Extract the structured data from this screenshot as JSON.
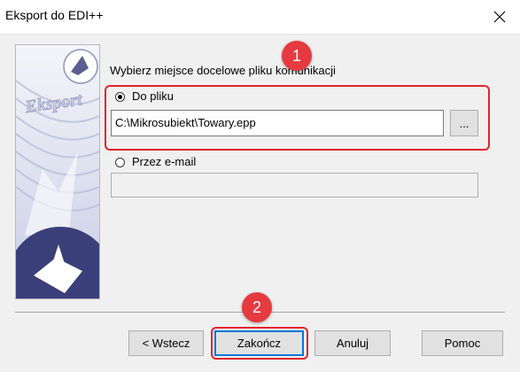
{
  "window": {
    "title": "Eksport do EDI++"
  },
  "side_image": {
    "text": "Eksport"
  },
  "prompt": "Wybierz miejsce docelowe pliku komunikacji",
  "options": {
    "file": {
      "label": "Do pliku",
      "selected": true,
      "path": "C:\\Mikrosubiekt\\Towary.epp",
      "browse_label": "..."
    },
    "email": {
      "label": "Przez e-mail",
      "selected": false,
      "value": ""
    }
  },
  "buttons": {
    "back": "< Wstecz",
    "finish": "Zakończ",
    "cancel": "Anuluj",
    "help": "Pomoc"
  },
  "annotations": {
    "badge1": "1",
    "badge2": "2"
  },
  "colors": {
    "annotation_red": "#e0252b",
    "badge_fill": "#e53a3f",
    "default_button_border": "#0078d7"
  }
}
